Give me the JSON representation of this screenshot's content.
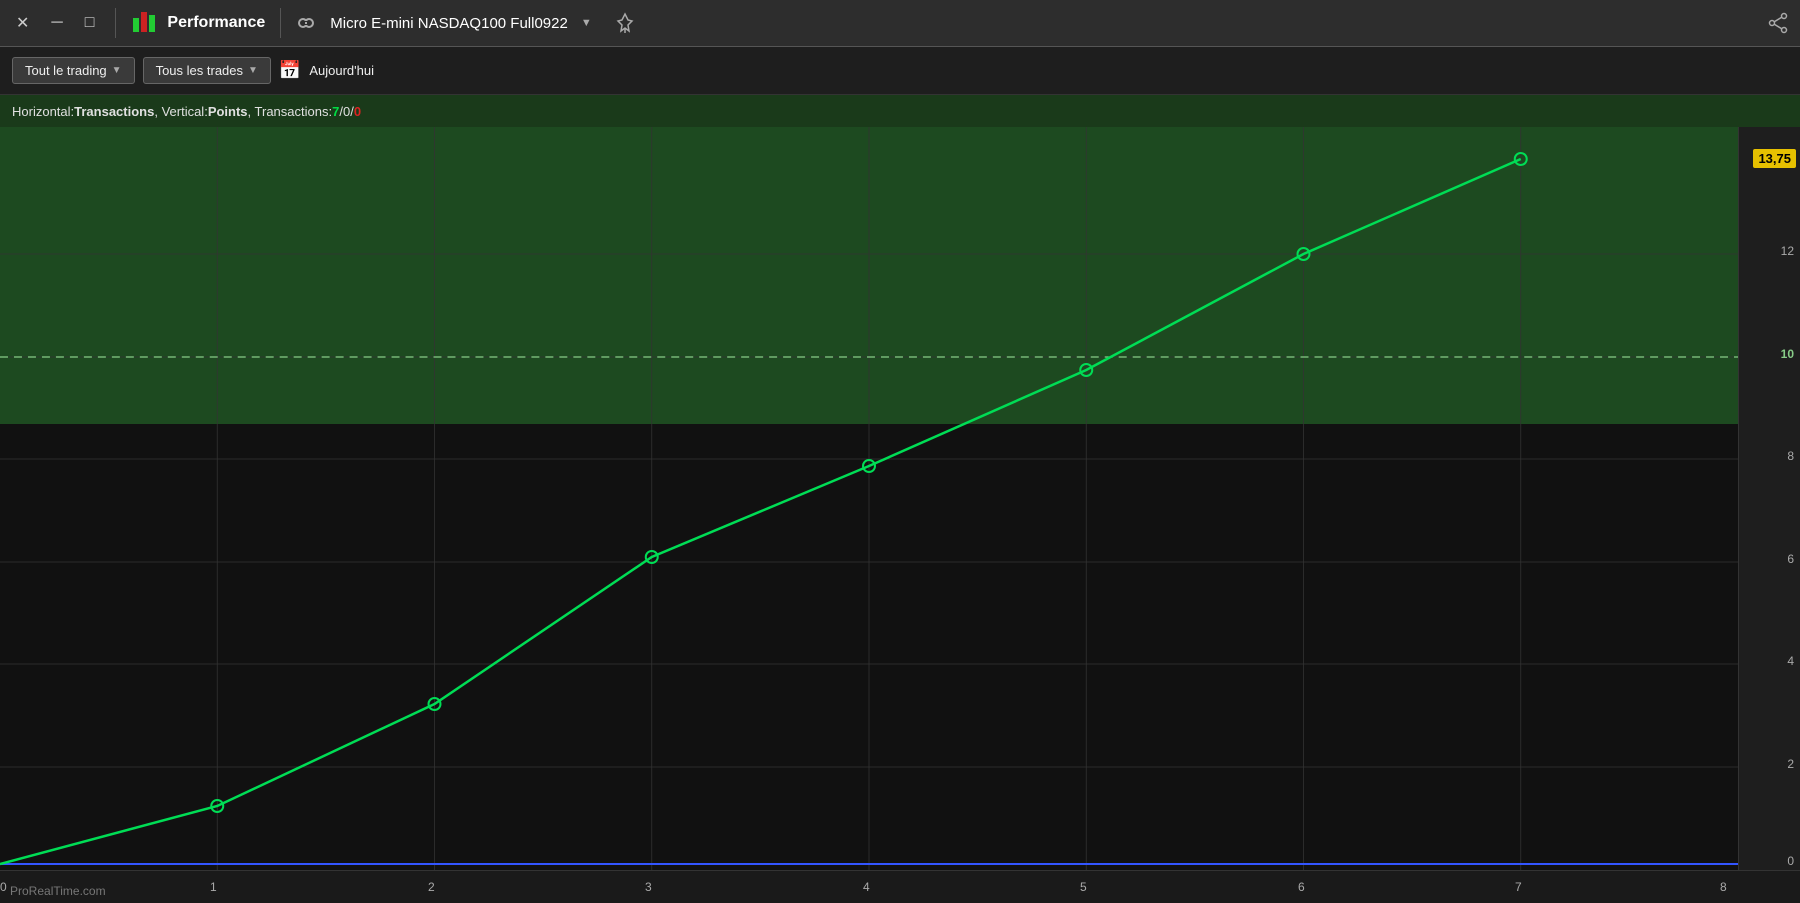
{
  "titlebar": {
    "close_label": "✕",
    "minimize_label": "─",
    "maximize_label": "□",
    "perf_icon": "📊",
    "title": "Performance",
    "instrument": "Micro E-mini NASDAQ100 Full0922",
    "instrument_arrow": "▼",
    "pin_icon": "⚲",
    "share_icon": "⎘"
  },
  "toolbar": {
    "trading_filter": "Tout le trading",
    "trades_filter": "Tous les trades",
    "today_label": "Aujourd'hui",
    "calendar_icon": "📅"
  },
  "infobar": {
    "prefix": "Horizontal: ",
    "h_bold": "Transactions",
    "comma1": ", Vertical: ",
    "v_bold": "Points",
    "comma2": ", Transactions: ",
    "count_green": "7",
    "slash1": " / ",
    "count_neutral": "0",
    "slash2": " / ",
    "count_red": "0"
  },
  "chart": {
    "current_value": "13,75",
    "dashed_line_value": "10",
    "dashed_line_color": "#88cc88",
    "y_axis_labels": [
      "13,75",
      "12",
      "10",
      "8",
      "6",
      "4",
      "2",
      "0"
    ],
    "x_axis_labels": [
      "0",
      "1",
      "2",
      "3",
      "4",
      "5",
      "6",
      "7",
      "8"
    ],
    "data_points": [
      {
        "x": 0,
        "y": 0
      },
      {
        "x": 1,
        "y": 1.25
      },
      {
        "x": 2,
        "y": 3.25
      },
      {
        "x": 3,
        "y": 6.0
      },
      {
        "x": 4,
        "y": 7.75
      },
      {
        "x": 5,
        "y": 9.75
      },
      {
        "x": 6,
        "y": 12.0
      },
      {
        "x": 7,
        "y": 13.75
      }
    ],
    "zero_line_color": "#3355ff",
    "line_color": "#00dd55",
    "point_color": "#00dd55"
  },
  "watermark": {
    "text": "ProRealTime.com"
  }
}
